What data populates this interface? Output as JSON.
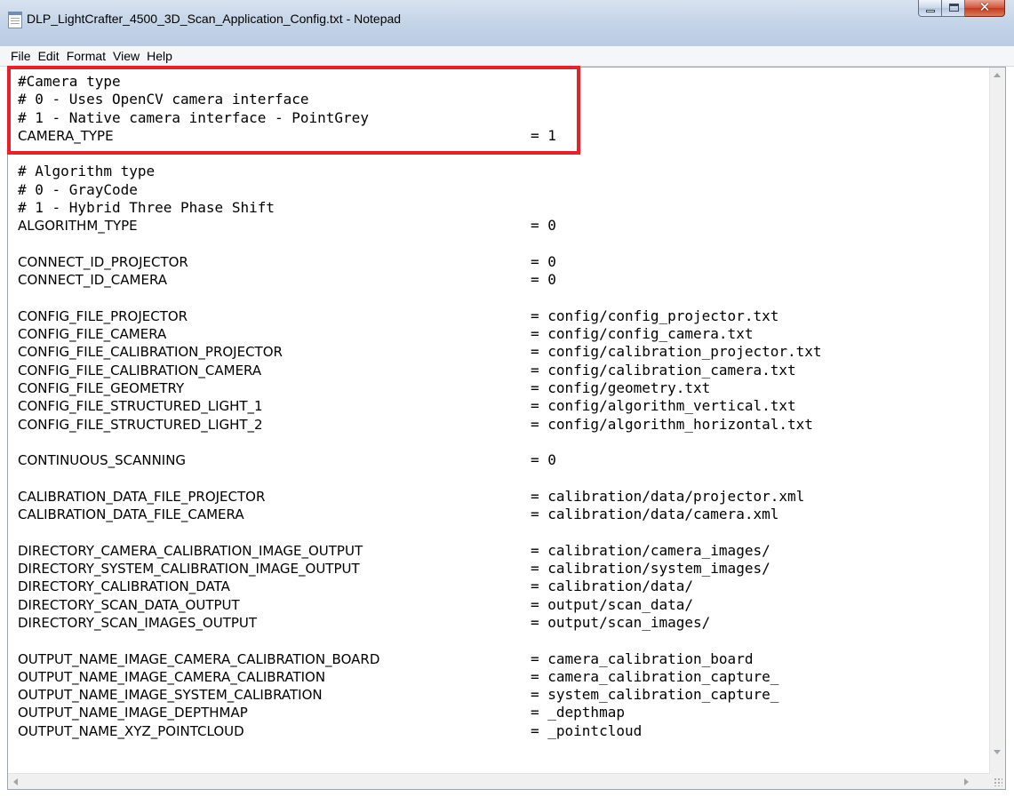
{
  "window": {
    "title": "DLP_LightCrafter_4500_3D_Scan_Application_Config.txt - Notepad",
    "app_icon": "notepad-icon",
    "caption_buttons": {
      "minimize": "minimize-icon",
      "maximize": "maximize-icon",
      "close": "close-icon"
    }
  },
  "menu": [
    "File",
    "Edit",
    "Format",
    "View",
    "Help"
  ],
  "highlight_color": "#e8202a",
  "lines": [
    {
      "text": "#Camera type",
      "mono": true
    },
    {
      "text": "# 0 - Uses OpenCV camera interface",
      "mono": true
    },
    {
      "text": "# 1 - Native camera interface - PointGrey",
      "mono": true
    },
    {
      "key": "CAMERA_TYPE",
      "val": "= 1"
    },
    {
      "text": ""
    },
    {
      "text": "# Algorithm type",
      "mono": true
    },
    {
      "text": "# 0 - GrayCode",
      "mono": true
    },
    {
      "text": "# 1 - Hybrid Three Phase Shift",
      "mono": true
    },
    {
      "key": "ALGORITHM_TYPE",
      "val": "= 0"
    },
    {
      "text": ""
    },
    {
      "key": "CONNECT_ID_PROJECTOR",
      "val": "= 0"
    },
    {
      "key": "CONNECT_ID_CAMERA",
      "val": "= 0"
    },
    {
      "text": ""
    },
    {
      "key": "CONFIG_FILE_PROJECTOR",
      "val": "= config/config_projector.txt"
    },
    {
      "key": "CONFIG_FILE_CAMERA",
      "val": "= config/config_camera.txt"
    },
    {
      "key": "CONFIG_FILE_CALIBRATION_PROJECTOR",
      "val": "= config/calibration_projector.txt"
    },
    {
      "key": "CONFIG_FILE_CALIBRATION_CAMERA",
      "val": "= config/calibration_camera.txt"
    },
    {
      "key": "CONFIG_FILE_GEOMETRY",
      "val": "= config/geometry.txt"
    },
    {
      "key": "CONFIG_FILE_STRUCTURED_LIGHT_1",
      "val": "= config/algorithm_vertical.txt"
    },
    {
      "key": "CONFIG_FILE_STRUCTURED_LIGHT_2",
      "val": "= config/algorithm_horizontal.txt"
    },
    {
      "text": ""
    },
    {
      "key": "CONTINUOUS_SCANNING",
      "val": "= 0"
    },
    {
      "text": ""
    },
    {
      "key": "CALIBRATION_DATA_FILE_PROJECTOR",
      "val": "= calibration/data/projector.xml"
    },
    {
      "key": "CALIBRATION_DATA_FILE_CAMERA",
      "val": "= calibration/data/camera.xml"
    },
    {
      "text": ""
    },
    {
      "key": "DIRECTORY_CAMERA_CALIBRATION_IMAGE_OUTPUT",
      "val": "= calibration/camera_images/"
    },
    {
      "key": "DIRECTORY_SYSTEM_CALIBRATION_IMAGE_OUTPUT",
      "val": "= calibration/system_images/"
    },
    {
      "key": "DIRECTORY_CALIBRATION_DATA",
      "val": "= calibration/data/"
    },
    {
      "key": "DIRECTORY_SCAN_DATA_OUTPUT",
      "val": "= output/scan_data/"
    },
    {
      "key": "DIRECTORY_SCAN_IMAGES_OUTPUT",
      "val": "= output/scan_images/"
    },
    {
      "text": ""
    },
    {
      "key": "OUTPUT_NAME_IMAGE_CAMERA_CALIBRATION_BOARD",
      "val": "= camera_calibration_board"
    },
    {
      "key": "OUTPUT_NAME_IMAGE_CAMERA_CALIBRATION",
      "val": "= camera_calibration_capture_"
    },
    {
      "key": "OUTPUT_NAME_IMAGE_SYSTEM_CALIBRATION",
      "val": "= system_calibration_capture_"
    },
    {
      "key": "OUTPUT_NAME_IMAGE_DEPTHMAP",
      "val": "= _depthmap"
    },
    {
      "key": "OUTPUT_NAME_XYZ_POINTCLOUD",
      "val": "= _pointcloud"
    }
  ]
}
